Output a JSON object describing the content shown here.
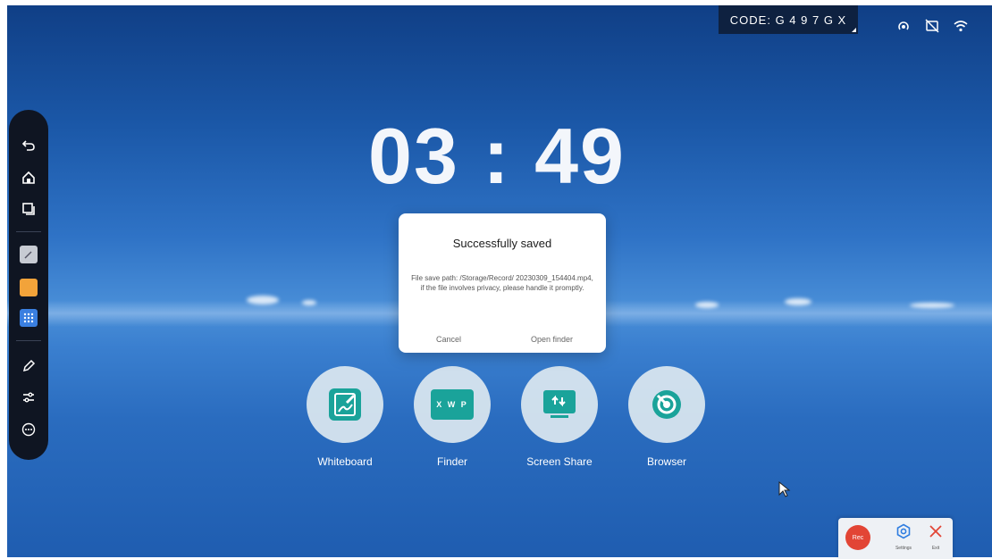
{
  "status_bar": {
    "code_text": "CODE: G 4 9 7 G X",
    "icons": [
      "hotspot-icon",
      "no-screen-icon",
      "wifi-icon"
    ]
  },
  "toolbar": {
    "items": [
      "back-icon",
      "home-icon",
      "windows-icon",
      "whiteboard-thumb-icon",
      "note-thumb-icon",
      "apps-grid-icon",
      "pen-icon",
      "adjust-icon",
      "more-icon"
    ]
  },
  "clock": {
    "time": "03 : 49"
  },
  "dialog": {
    "title": "Successfully saved",
    "message": "File save path: /Storage/Record/ 20230309_154404.mp4, if the file involves privacy, please handle it promptly.",
    "cancel_label": "Cancel",
    "open_label": "Open finder"
  },
  "apps": [
    {
      "label": "Whiteboard",
      "icon": "whiteboard-icon"
    },
    {
      "label": "Finder",
      "icon": "finder-icon",
      "icon_text": "X W P"
    },
    {
      "label": "Screen Share",
      "icon": "screen-share-icon"
    },
    {
      "label": "Browser",
      "icon": "browser-icon"
    }
  ],
  "record_panel": {
    "rec_label": "Rec",
    "settings_label": "Settings",
    "exit_label": "Exit"
  },
  "colors": {
    "accent_teal": "#1aa39a",
    "rec_red": "#e24535",
    "settings_blue": "#2f7de0"
  }
}
